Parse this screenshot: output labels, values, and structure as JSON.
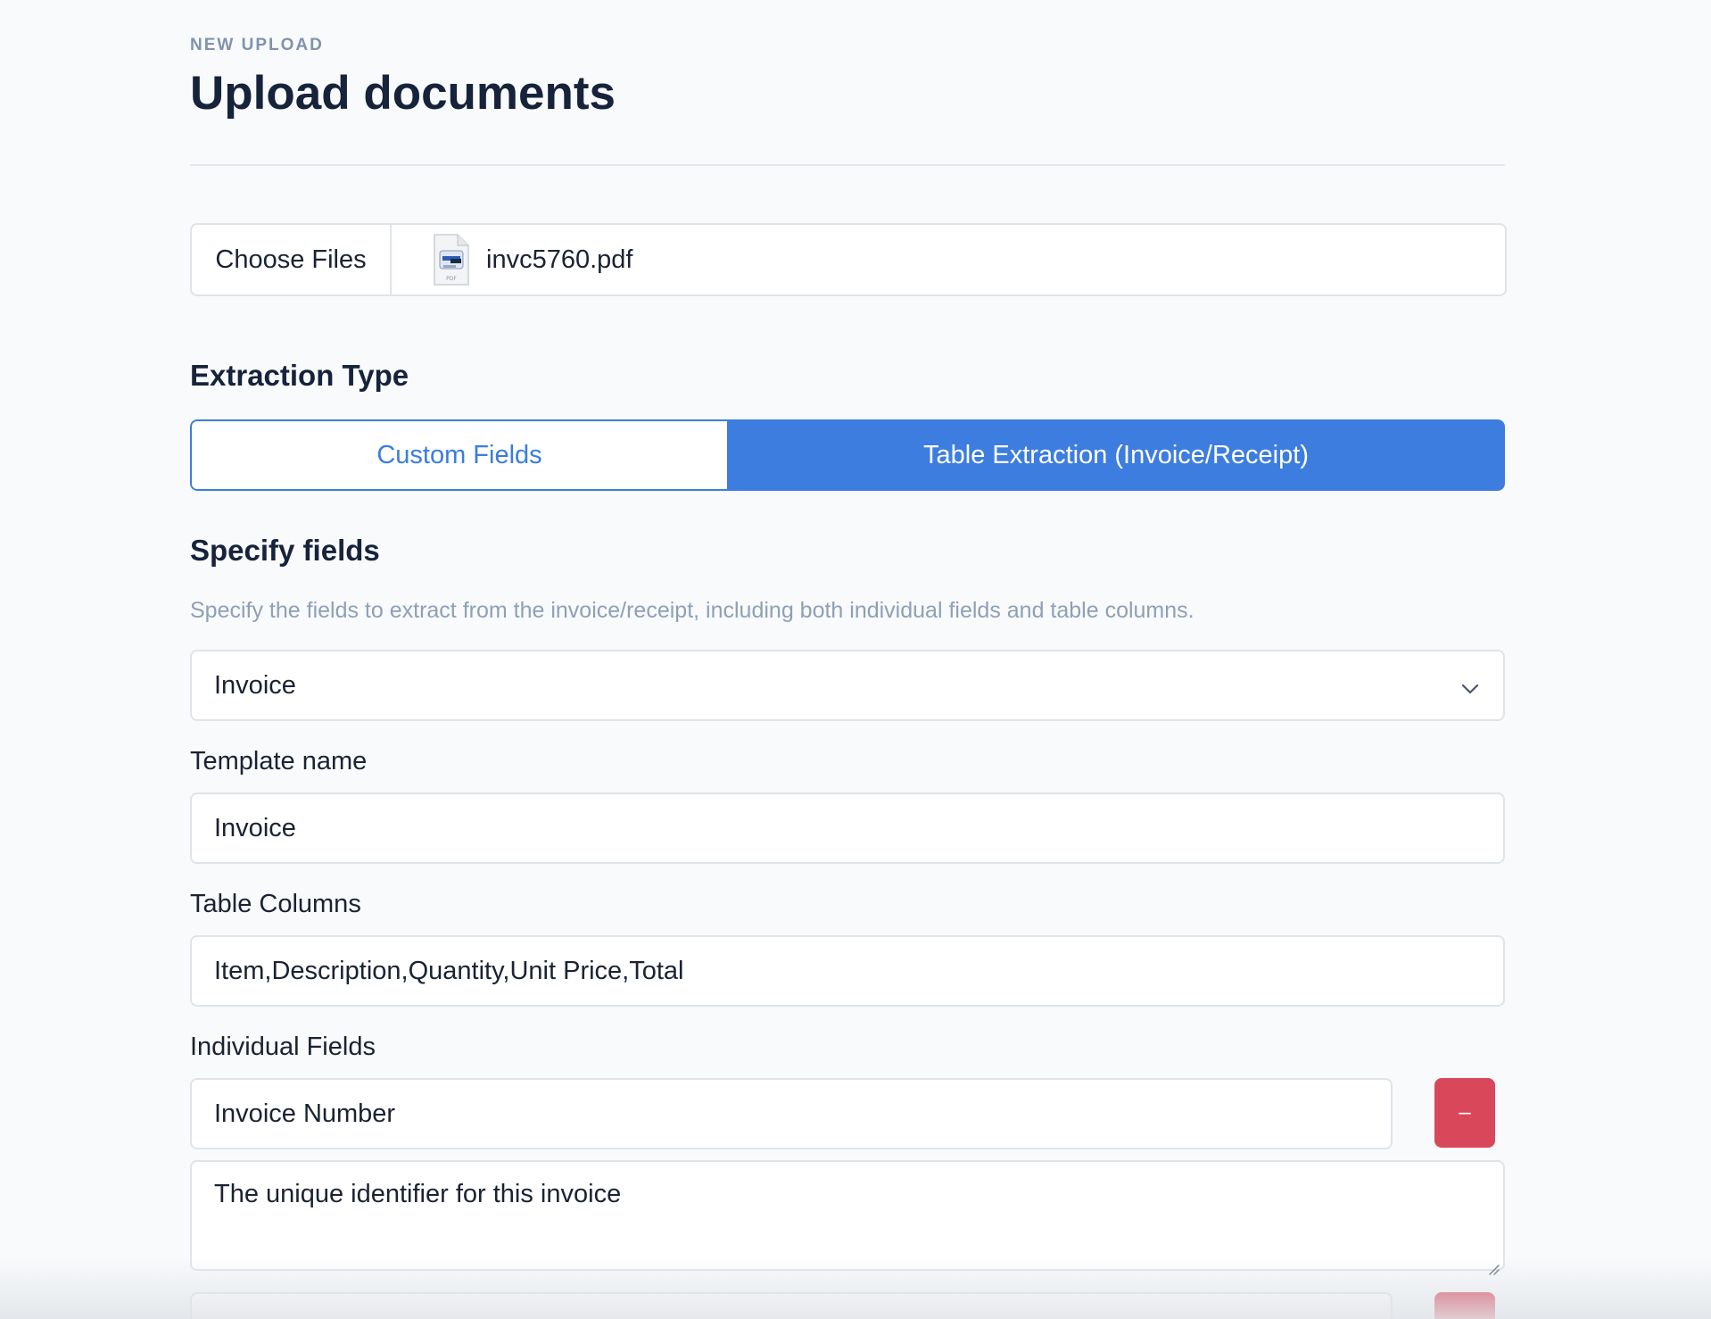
{
  "header": {
    "eyebrow": "NEW UPLOAD",
    "title": "Upload documents"
  },
  "file_picker": {
    "button_label": "Choose Files",
    "file_name": "invc5760.pdf",
    "file_icon": "pdf-file-icon"
  },
  "extraction_type": {
    "label": "Extraction Type",
    "options": [
      "Custom Fields",
      "Table Extraction (Invoice/Receipt)"
    ],
    "selected": "Table Extraction (Invoice/Receipt)"
  },
  "specify_fields": {
    "heading": "Specify fields",
    "help": "Specify the fields to extract from the invoice/receipt, including both individual fields and table columns.",
    "template_select_value": "Invoice"
  },
  "template_name": {
    "label": "Template name",
    "value": "Invoice"
  },
  "table_columns": {
    "label": "Table Columns",
    "value": "Item,Description,Quantity,Unit Price,Total"
  },
  "individual_fields": {
    "label": "Individual Fields",
    "items": [
      {
        "name": "Invoice Number",
        "description": "The unique identifier for this invoice",
        "remove_label": "–"
      }
    ]
  },
  "colors": {
    "accent": "#3d7de0",
    "danger": "#d9475b",
    "muted": "#8fa0b6"
  }
}
